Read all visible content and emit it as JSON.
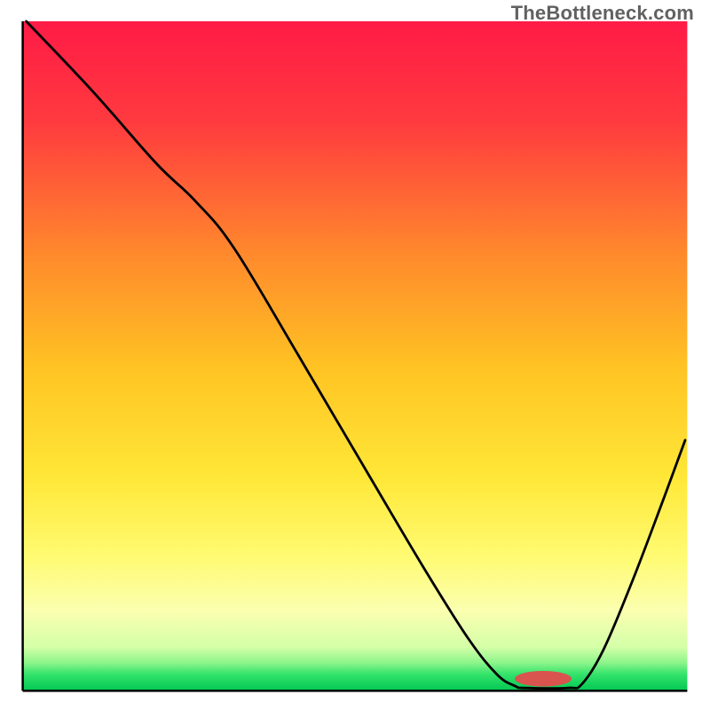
{
  "watermark": "TheBottleneck.com",
  "chart_data": {
    "type": "line",
    "title": "",
    "xlabel": "",
    "ylabel": "",
    "xlim": [
      0,
      100
    ],
    "ylim": [
      0,
      100
    ],
    "gradient_stops": [
      {
        "offset": 0.0,
        "color": "#ff1b46"
      },
      {
        "offset": 0.15,
        "color": "#ff3a3f"
      },
      {
        "offset": 0.35,
        "color": "#ff8a2c"
      },
      {
        "offset": 0.52,
        "color": "#ffc423"
      },
      {
        "offset": 0.68,
        "color": "#ffe737"
      },
      {
        "offset": 0.8,
        "color": "#fffb72"
      },
      {
        "offset": 0.88,
        "color": "#fbffb0"
      },
      {
        "offset": 0.935,
        "color": "#d4ffa8"
      },
      {
        "offset": 0.958,
        "color": "#8cf58a"
      },
      {
        "offset": 0.975,
        "color": "#34e36b"
      },
      {
        "offset": 1.0,
        "color": "#00c853"
      }
    ],
    "background_rect": {
      "x": 3.2,
      "y": 3.0,
      "w": 93.6,
      "h": 94.3
    },
    "axis_lines": [
      {
        "x1": 3.2,
        "y1": 97.3,
        "x2": 96.8,
        "y2": 97.3
      },
      {
        "x1": 3.2,
        "y1": 3.0,
        "x2": 3.2,
        "y2": 97.3
      }
    ],
    "series": [
      {
        "name": "bottleneck-curve",
        "type": "path",
        "color": "#000000",
        "width": 0.35,
        "points": [
          {
            "x": 3.7,
            "y": 3.0
          },
          {
            "x": 13.0,
            "y": 12.8
          },
          {
            "x": 22.0,
            "y": 23.0
          },
          {
            "x": 27.5,
            "y": 28.3
          },
          {
            "x": 33.0,
            "y": 35.0
          },
          {
            "x": 42.0,
            "y": 50.0
          },
          {
            "x": 52.0,
            "y": 67.0
          },
          {
            "x": 60.0,
            "y": 80.5
          },
          {
            "x": 66.0,
            "y": 90.0
          },
          {
            "x": 70.0,
            "y": 95.0
          },
          {
            "x": 72.5,
            "y": 96.6
          },
          {
            "x": 74.0,
            "y": 96.9
          },
          {
            "x": 80.0,
            "y": 96.9
          },
          {
            "x": 82.0,
            "y": 96.3
          },
          {
            "x": 85.0,
            "y": 91.5
          },
          {
            "x": 89.0,
            "y": 82.0
          },
          {
            "x": 93.0,
            "y": 71.5
          },
          {
            "x": 96.5,
            "y": 62.0
          }
        ]
      }
    ],
    "marker": {
      "name": "optimum-marker",
      "color": "#d9534f",
      "cx": 76.5,
      "cy": 95.6,
      "rx": 4.0,
      "ry": 1.1
    }
  }
}
